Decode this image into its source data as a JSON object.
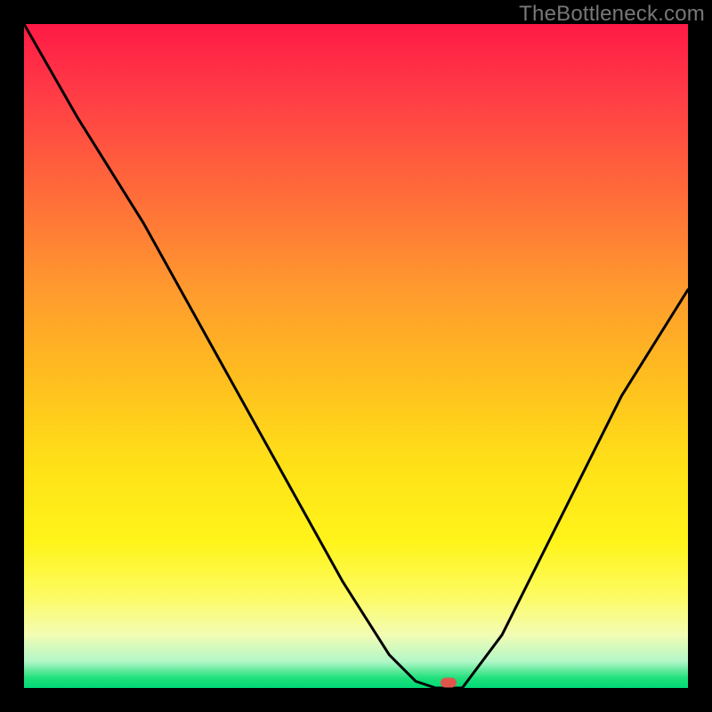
{
  "attribution": "TheBottleneck.com",
  "chart_data": {
    "type": "line",
    "title": "",
    "xlabel": "",
    "ylabel": "",
    "xlim": [
      0,
      100
    ],
    "ylim": [
      0,
      100
    ],
    "grid": false,
    "legend": false,
    "series": [
      {
        "name": "curve",
        "x": [
          0,
          8,
          18,
          28,
          38,
          48,
          55,
          59,
          62,
          66,
          72,
          80,
          90,
          100
        ],
        "y": [
          100,
          86,
          70,
          52,
          34,
          16,
          5,
          1,
          0,
          0,
          8,
          24,
          44,
          60
        ]
      }
    ],
    "marker": {
      "x": 64,
      "y": 0.8
    },
    "background_gradient_stops": [
      {
        "pos": 0,
        "color": "#ff1a46"
      },
      {
        "pos": 0.25,
        "color": "#ff6a3a"
      },
      {
        "pos": 0.52,
        "color": "#ffba20"
      },
      {
        "pos": 0.78,
        "color": "#fff41a"
      },
      {
        "pos": 0.96,
        "color": "#b2f7c8"
      },
      {
        "pos": 1.0,
        "color": "#00d977"
      }
    ]
  }
}
